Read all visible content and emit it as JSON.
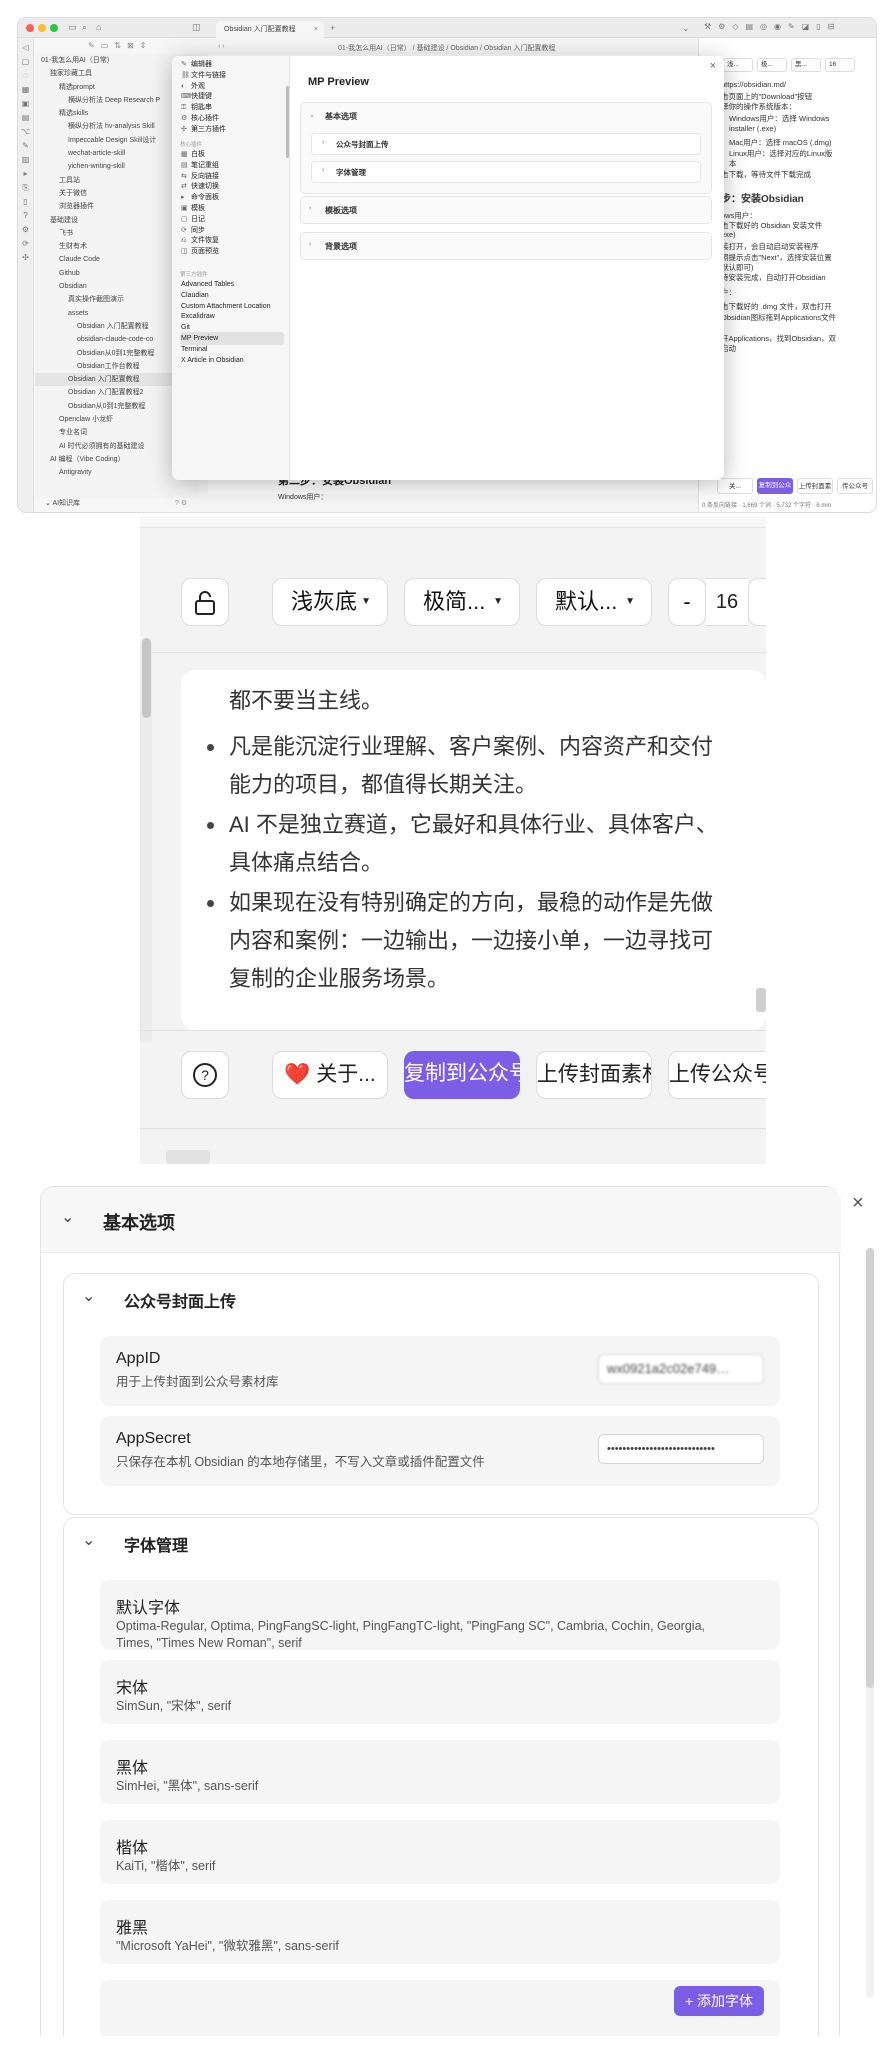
{
  "window": {
    "tab_title": "Obsidian 入门配置教程",
    "breadcrumb": "01-我怎么用AI（日常） / 基础建设 / Obsidian / Obsidian 入门配置教程",
    "vault_name": "AI知识库",
    "file_tree": [
      "01-我怎么用AI（日常）",
      "独家珍藏工具",
      "精选prompt",
      "横纵分析法 Deep Research P",
      "精选skills",
      "横纵分析法 hv-analysis Skill",
      "Impeccable Design Skill设计",
      "wechat-article-skill",
      "yichen-writing-skill",
      "工具站",
      "关于微信",
      "浏览器插件",
      "基础建设",
      "飞书",
      "生财有术",
      "Claude Code",
      "Github",
      "Obsidian",
      "真实操作截图演示",
      "assets",
      "Obsidian 入门配置教程",
      "obsidian-claude-code-co",
      "Obsidian从0到1完整教程",
      "Obsidian工作台教程",
      "Obsidian 入门配置教程",
      "Obsidian 入门配置教程2",
      "Obsidian从0到1完整教程",
      "Openclaw 小龙虾",
      "专业名词",
      "AI 时代必须拥有的基础建设",
      "AI 编程（Vibe Coding）",
      "Antigravity"
    ],
    "right_pane": [
      "https://obsidian.md/",
      "击页面上的\"Download\"按钮",
      "择你的操作系统版本：",
      "Windows用户：选择 Windows",
      "installer (.exe)",
      "Mac用户：选择 macOS (.dmg)",
      "Linux用户：选择对应的Linux版",
      "本",
      "击下载，等待文件下载完成",
      "步：安装Obsidian",
      "ows用户：",
      "击下载好的 Obsidian 安装文件",
      "exe)",
      "装打开，会自动启动安装程序",
      "照提示点击\"Next\"，选择安装位置",
      "默认即可)",
      "待安装完成，自动打开Obsidian",
      "户：",
      "击下载好的 .dmg 文件，双击打开",
      "Obsidian图标拖到Applications文件",
      "开Applications，找到Obsidian，双",
      "启动"
    ],
    "doc_lines": [
      "第二步：安装Obsidian",
      "Windows用户："
    ],
    "status_bar": "0 条反向链接 · 1,669 个词 · 5,732 个字符 · 6 min",
    "right_toolbar": [
      "浅...",
      "极...",
      "黑...",
      "16"
    ],
    "right_buttons": [
      "关...",
      "复制到公众",
      "上传封面素",
      "传公众号"
    ]
  },
  "settings_modal": {
    "title": "MP Preview",
    "nav_groups": [
      {
        "label": "",
        "items": [
          {
            "icon": "edit-icon",
            "label": "编辑器"
          },
          {
            "icon": "link-icon",
            "label": "文件与链接"
          },
          {
            "icon": "palette-icon",
            "label": "外观"
          },
          {
            "icon": "keyboard-icon",
            "label": "快捷键"
          },
          {
            "icon": "key-icon",
            "label": "钥匙串"
          },
          {
            "icon": "plugin-icon",
            "label": "核心插件"
          },
          {
            "icon": "puzzle-icon",
            "label": "第三方插件"
          }
        ]
      },
      {
        "label": "核心插件",
        "items": [
          {
            "icon": "canvas-icon",
            "label": "白板"
          },
          {
            "icon": "note-icon",
            "label": "笔记重组"
          },
          {
            "icon": "backlink-icon",
            "label": "反向链接"
          },
          {
            "icon": "switch-icon",
            "label": "快速切换"
          },
          {
            "icon": "terminal-icon",
            "label": "命令面板"
          },
          {
            "icon": "template-icon",
            "label": "模板"
          },
          {
            "icon": "calendar-icon",
            "label": "日记"
          },
          {
            "icon": "sync-icon",
            "label": "同步"
          },
          {
            "icon": "recovery-icon",
            "label": "文件恢复"
          },
          {
            "icon": "preview-icon",
            "label": "页面预览"
          }
        ]
      },
      {
        "label": "第三方插件",
        "items": [
          {
            "label": "Advanced Tables"
          },
          {
            "label": "Claudian"
          },
          {
            "label": "Custom Attachment Location"
          },
          {
            "label": "Excalidraw"
          },
          {
            "label": "Git"
          },
          {
            "label": "MP Preview"
          },
          {
            "label": "Terminal"
          },
          {
            "label": "X Article in Obsidian"
          }
        ]
      }
    ],
    "groups": [
      "基本选项",
      "模板选项",
      "背景选项"
    ],
    "sub_groups": [
      "公众号封面上传",
      "字体管理"
    ]
  },
  "preview": {
    "toolbar": {
      "lock": "lock-icon",
      "bg_select": "浅灰底",
      "theme_select": "极简...",
      "font_select": "默认...",
      "minus": "-",
      "font_size": "16",
      "plus": "-"
    },
    "bullets": [
      "都不要当主线。",
      "凡是能沉淀行业理解、客户案例、内容资产和交付能力的项目，都值得长期关注。",
      "AI 不是独立赛道，它最好和具体行业、具体客户、具体痛点结合。",
      "如果现在没有特别确定的方向，最稳的动作是先做内容和案例：一边输出，一边接小单，一边寻找可复制的企业服务场景。"
    ],
    "buttons": {
      "help": "?",
      "about": "❤️ 关于...",
      "copy": "复制到公众号",
      "upload_cover": "上传封面素材",
      "upload_draft": "上传公众号草"
    },
    "accent": "#7b5ee6"
  },
  "settings": {
    "section_title": "基本选项",
    "cover": {
      "title": "公众号封面上传",
      "appid_label": "AppID",
      "appid_desc": "用于上传封面到公众号素材库",
      "appid_value": "wx0921a2c02e749…",
      "secret_label": "AppSecret",
      "secret_desc": "只保存在本机 Obsidian 的本地存储里，不写入文章或插件配置文件",
      "secret_value": "••••••••••••••••••••••••••••"
    },
    "fonts": {
      "title": "字体管理",
      "items": [
        {
          "name": "默认字体",
          "stack": "Optima-Regular, Optima, PingFangSC-light, PingFangTC-light, \"PingFang SC\", Cambria, Cochin, Georgia, Times, \"Times New Roman\", serif"
        },
        {
          "name": "宋体",
          "stack": "SimSun, \"宋体\", serif"
        },
        {
          "name": "黑体",
          "stack": "SimHei, \"黑体\", sans-serif"
        },
        {
          "name": "楷体",
          "stack": "KaiTi, \"楷体\", serif"
        },
        {
          "name": "雅黑",
          "stack": "\"Microsoft YaHei\", \"微软雅黑\", sans-serif"
        }
      ],
      "add_button": "+ 添加字体"
    }
  }
}
